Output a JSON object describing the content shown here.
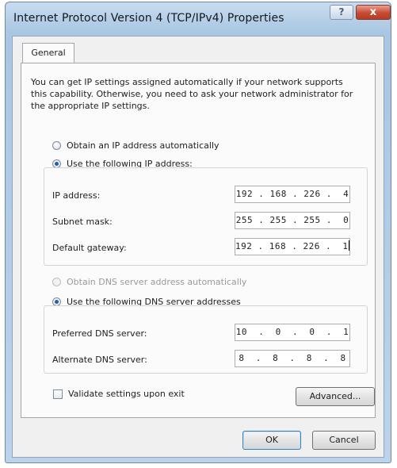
{
  "window": {
    "title": "Internet Protocol Version 4 (TCP/IPv4) Properties",
    "help_label": "?",
    "close_label": "x"
  },
  "tabs": [
    {
      "label": "General",
      "selected": true
    }
  ],
  "general": {
    "intro": "You can get IP settings assigned automatically if your network supports this capability. Otherwise, you need to ask your network administrator for the appropriate IP settings.",
    "ip": {
      "auto_label": "Obtain an IP address automatically",
      "manual_label": "Use the following IP address:",
      "selected": "manual",
      "fields": [
        {
          "label": "IP address:",
          "value": "192 . 168 . 226 .  4"
        },
        {
          "label": "Subnet mask:",
          "value": "255 . 255 . 255 .  0"
        },
        {
          "label": "Default gateway:",
          "value": "192 . 168 . 226 .  1"
        }
      ]
    },
    "dns": {
      "auto_label": "Obtain DNS server address automatically",
      "manual_label": "Use the following DNS server addresses",
      "selected": "manual",
      "fields": [
        {
          "label": "Preferred DNS server:",
          "value": "10  .  0  .  0  .  1"
        },
        {
          "label": "Alternate DNS server:",
          "value": "8  .  8  .  8  .  8"
        }
      ]
    },
    "validate_label": "Validate settings upon exit",
    "validate_checked": false,
    "advanced_label": "Advanced..."
  },
  "footer": {
    "ok_label": "OK",
    "cancel_label": "Cancel"
  }
}
